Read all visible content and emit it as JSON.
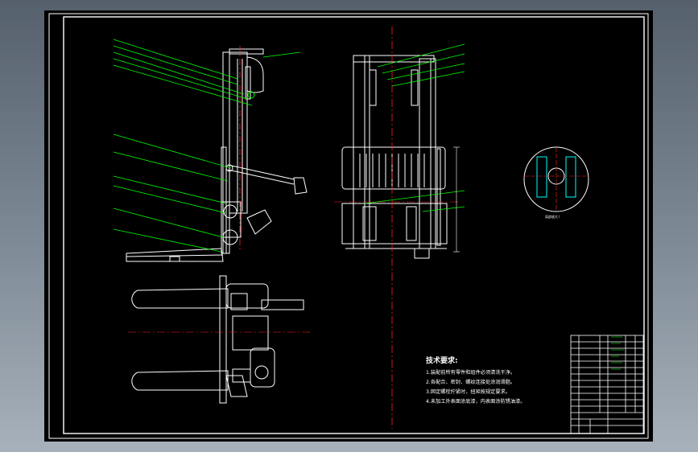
{
  "drawing": {
    "technical_requirements": {
      "title": "技术要求:",
      "items": [
        "1.装配前所有零件和组件必须清洗干净。",
        "2.各配合、密封、螺纹连接处涂润滑脂。",
        "3.固定螺栓拧紧时，扭矩按规定要求。",
        "4.未加工外表面涂底漆，内表面涂防锈油漆。"
      ]
    },
    "detail_label": "局部放大 I",
    "colors": {
      "background": "#000000",
      "line": "#ffffff",
      "leader": "#00ff00",
      "centerline": "#ff2020",
      "accent": "#ffff00"
    }
  }
}
